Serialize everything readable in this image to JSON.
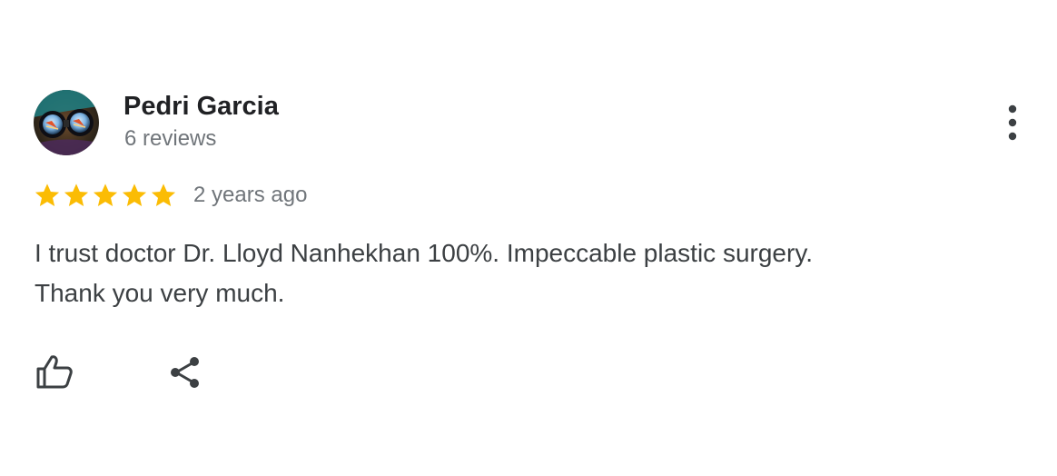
{
  "reviewer": {
    "name": "Pedri Garcia",
    "reviews_count": "6 reviews"
  },
  "rating": {
    "stars": 5,
    "max_stars": 5,
    "time": "2 years ago",
    "star_color": "#fbbc04"
  },
  "review": {
    "text_line_1": "I trust doctor Dr. Lloyd Nanhekhan 100%. Impeccable plastic surgery.",
    "text_line_2": "Thank you very much."
  },
  "actions": {
    "like_icon": "thumbs-up-icon",
    "share_icon": "share-icon",
    "more_icon": "more-vert-icon"
  },
  "colors": {
    "name": "#202124",
    "meta": "#70757a",
    "body": "#3c4043",
    "icon": "#5f6368"
  }
}
